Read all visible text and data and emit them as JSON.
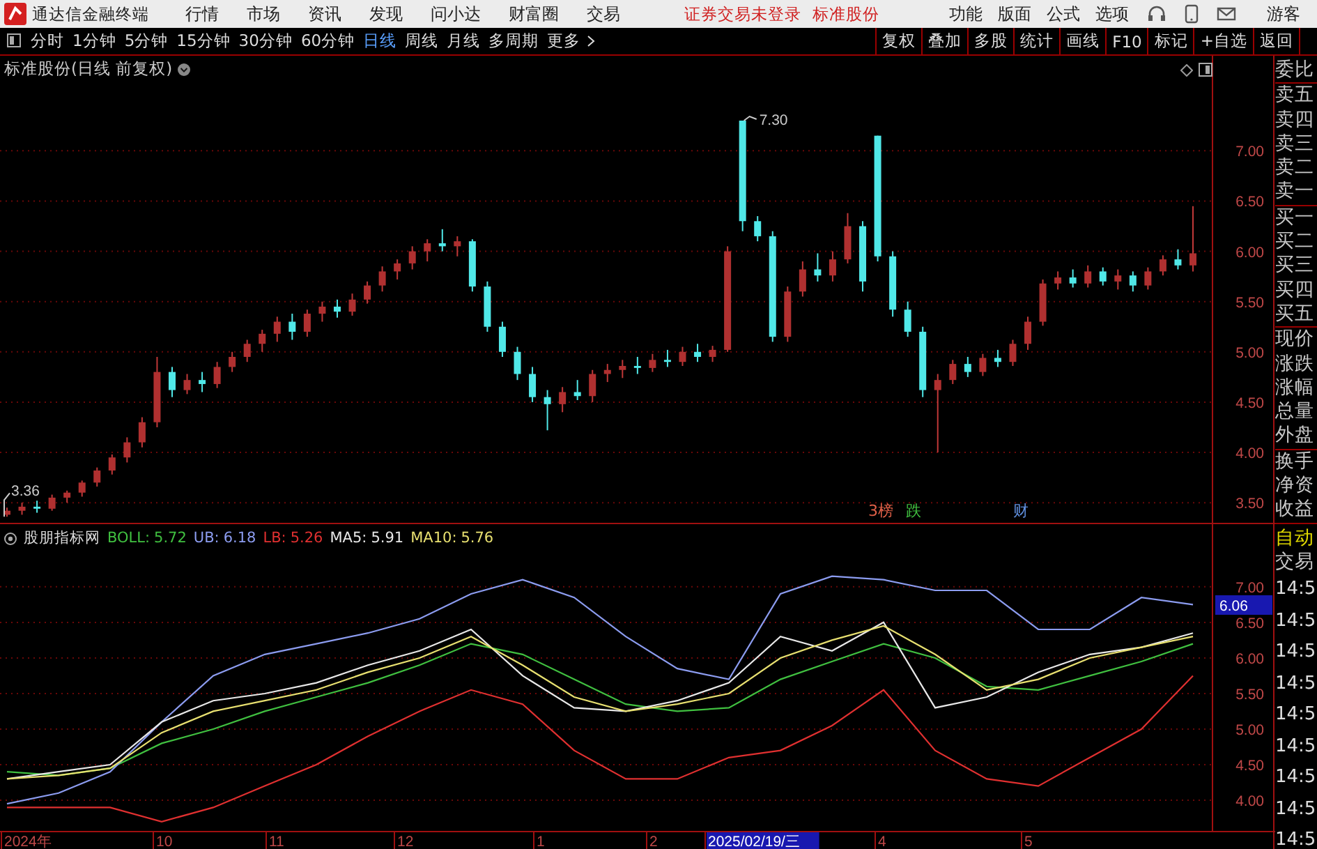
{
  "title_bar": {
    "app_name": "通达信金融终端",
    "menus": [
      "行情",
      "市场",
      "资讯",
      "发现",
      "问小达",
      "财富圈",
      "交易"
    ],
    "notice": "证券交易未登录",
    "stock_name": "标准股份",
    "tools": [
      "功能",
      "版面",
      "公式",
      "选项"
    ],
    "user": "游客"
  },
  "toolbar": {
    "periods": [
      {
        "label": "分时",
        "selected": false
      },
      {
        "label": "1分钟",
        "selected": false
      },
      {
        "label": "5分钟",
        "selected": false
      },
      {
        "label": "15分钟",
        "selected": false
      },
      {
        "label": "30分钟",
        "selected": false
      },
      {
        "label": "60分钟",
        "selected": false
      },
      {
        "label": "日线",
        "selected": true
      },
      {
        "label": "周线",
        "selected": false
      },
      {
        "label": "月线",
        "selected": false
      },
      {
        "label": "多周期",
        "selected": false
      }
    ],
    "more": "更多",
    "actions": [
      "复权",
      "叠加",
      "多股",
      "统计",
      "画线",
      "F10",
      "标记",
      "+自选",
      "返回"
    ]
  },
  "price_chart": {
    "title": "标准股份(日线 前复权)",
    "high_label": "7.30",
    "low_label": "3.36",
    "chart_data": {
      "type": "candlestick",
      "categories": [
        null,
        null,
        null,
        null,
        null,
        null,
        null,
        null,
        null,
        null,
        null,
        null,
        null,
        null,
        null,
        null,
        null,
        null,
        null,
        null,
        null,
        null,
        null,
        null,
        null,
        null,
        null,
        null,
        null,
        null,
        null,
        null,
        null,
        null,
        null,
        null,
        null,
        null,
        null,
        null,
        null,
        null,
        null,
        null,
        null,
        null,
        null,
        null,
        null,
        null,
        null,
        null,
        null,
        null,
        null,
        null,
        null,
        null,
        null,
        null,
        null,
        null,
        null,
        null,
        null,
        null,
        null,
        null,
        null,
        null,
        null,
        null,
        null,
        null,
        null,
        null,
        null,
        null,
        null,
        null
      ],
      "ylim": [
        3.3,
        7.945
      ],
      "grid": true,
      "yticks": [
        {
          "value": 7,
          "label": "7.00"
        },
        {
          "value": 6.5,
          "label": "6.50"
        },
        {
          "value": 6,
          "label": "6.00"
        },
        {
          "value": 5.5,
          "label": "5.50"
        },
        {
          "value": 5,
          "label": "5.00"
        },
        {
          "value": 4.5,
          "label": "4.50"
        },
        {
          "value": 4,
          "label": "4.00"
        },
        {
          "value": 3.5,
          "label": "3.50"
        }
      ],
      "ohlc": [
        [
          3.38,
          3.45,
          3.36,
          3.42
        ],
        [
          3.42,
          3.5,
          3.38,
          3.46
        ],
        [
          3.46,
          3.52,
          3.4,
          3.44
        ],
        [
          3.44,
          3.58,
          3.42,
          3.55
        ],
        [
          3.55,
          3.62,
          3.5,
          3.6
        ],
        [
          3.6,
          3.72,
          3.56,
          3.7
        ],
        [
          3.7,
          3.85,
          3.66,
          3.82
        ],
        [
          3.82,
          3.98,
          3.78,
          3.95
        ],
        [
          3.95,
          4.15,
          3.9,
          4.1
        ],
        [
          4.1,
          4.35,
          4.05,
          4.3
        ],
        [
          4.3,
          4.95,
          4.25,
          4.8
        ],
        [
          4.8,
          4.85,
          4.55,
          4.62
        ],
        [
          4.62,
          4.78,
          4.58,
          4.72
        ],
        [
          4.72,
          4.8,
          4.6,
          4.68
        ],
        [
          4.68,
          4.9,
          4.64,
          4.85
        ],
        [
          4.85,
          5.0,
          4.8,
          4.95
        ],
        [
          4.95,
          5.12,
          4.9,
          5.08
        ],
        [
          5.08,
          5.22,
          5.0,
          5.18
        ],
        [
          5.18,
          5.35,
          5.1,
          5.3
        ],
        [
          5.3,
          5.38,
          5.12,
          5.2
        ],
        [
          5.2,
          5.42,
          5.15,
          5.38
        ],
        [
          5.38,
          5.5,
          5.3,
          5.45
        ],
        [
          5.45,
          5.52,
          5.34,
          5.4
        ],
        [
          5.4,
          5.58,
          5.36,
          5.52
        ],
        [
          5.52,
          5.7,
          5.48,
          5.66
        ],
        [
          5.66,
          5.85,
          5.6,
          5.8
        ],
        [
          5.8,
          5.92,
          5.72,
          5.88
        ],
        [
          5.88,
          6.05,
          5.82,
          6.0
        ],
        [
          6.0,
          6.12,
          5.9,
          6.08
        ],
        [
          6.08,
          6.22,
          6.0,
          6.05
        ],
        [
          6.05,
          6.15,
          5.95,
          6.1
        ],
        [
          6.1,
          6.12,
          5.6,
          5.65
        ],
        [
          5.65,
          5.7,
          5.2,
          5.25
        ],
        [
          5.25,
          5.3,
          4.95,
          5.0
        ],
        [
          5.0,
          5.05,
          4.72,
          4.78
        ],
        [
          4.78,
          4.85,
          4.5,
          4.55
        ],
        [
          4.55,
          4.62,
          4.22,
          4.48
        ],
        [
          4.48,
          4.65,
          4.4,
          4.6
        ],
        [
          4.6,
          4.72,
          4.52,
          4.56
        ],
        [
          4.56,
          4.82,
          4.5,
          4.78
        ],
        [
          4.78,
          4.88,
          4.7,
          4.82
        ],
        [
          4.82,
          4.92,
          4.74,
          4.86
        ],
        [
          4.86,
          4.95,
          4.78,
          4.84
        ],
        [
          4.84,
          4.98,
          4.8,
          4.92
        ],
        [
          4.92,
          5.02,
          4.85,
          4.9
        ],
        [
          4.9,
          5.05,
          4.86,
          5.0
        ],
        [
          5.0,
          5.08,
          4.9,
          4.95
        ],
        [
          4.95,
          5.06,
          4.9,
          5.02
        ],
        [
          5.02,
          6.05,
          5.0,
          6.0
        ],
        [
          7.3,
          7.3,
          6.2,
          6.3
        ],
        [
          6.3,
          6.35,
          6.1,
          6.15
        ],
        [
          6.15,
          6.2,
          5.1,
          5.15
        ],
        [
          5.15,
          5.65,
          5.1,
          5.6
        ],
        [
          5.6,
          5.9,
          5.55,
          5.82
        ],
        [
          5.82,
          5.98,
          5.7,
          5.76
        ],
        [
          5.76,
          6.0,
          5.7,
          5.92
        ],
        [
          5.92,
          6.38,
          5.88,
          6.25
        ],
        [
          6.25,
          6.3,
          5.6,
          5.7
        ],
        [
          7.15,
          7.15,
          5.9,
          5.95
        ],
        [
          5.95,
          6.0,
          5.35,
          5.42
        ],
        [
          5.42,
          5.5,
          5.15,
          5.2
        ],
        [
          5.2,
          5.25,
          4.55,
          4.62
        ],
        [
          4.62,
          4.78,
          4.0,
          4.72
        ],
        [
          4.72,
          4.92,
          4.68,
          4.88
        ],
        [
          4.88,
          4.95,
          4.75,
          4.8
        ],
        [
          4.8,
          4.98,
          4.76,
          4.94
        ],
        [
          4.94,
          5.02,
          4.85,
          4.9
        ],
        [
          4.9,
          5.12,
          4.86,
          5.08
        ],
        [
          5.08,
          5.35,
          5.02,
          5.3
        ],
        [
          5.3,
          5.72,
          5.26,
          5.68
        ],
        [
          5.68,
          5.8,
          5.62,
          5.74
        ],
        [
          5.74,
          5.82,
          5.64,
          5.68
        ],
        [
          5.68,
          5.86,
          5.64,
          5.8
        ],
        [
          5.8,
          5.84,
          5.66,
          5.7
        ],
        [
          5.7,
          5.82,
          5.62,
          5.76
        ],
        [
          5.76,
          5.8,
          5.6,
          5.66
        ],
        [
          5.66,
          5.84,
          5.62,
          5.8
        ],
        [
          5.8,
          5.96,
          5.76,
          5.92
        ],
        [
          5.92,
          6.02,
          5.82,
          5.86
        ],
        [
          5.86,
          6.45,
          5.8,
          5.98
        ]
      ]
    },
    "event_markers": [
      {
        "label": "3榜",
        "color": "#e06048"
      },
      {
        "label": "跌",
        "color": "#40c040"
      },
      {
        "label": "财",
        "color": "#6090e0"
      }
    ]
  },
  "indicator": {
    "name": "股朋指标网",
    "legend": [
      "5.72",
      "6.18",
      "5.26",
      "5.91",
      "5.76"
    ],
    "current_value": "6.06",
    "chart_data": {
      "type": "line",
      "categories": [
        null,
        null,
        null,
        null,
        null,
        null,
        null,
        null,
        null,
        null,
        null,
        null,
        null,
        null,
        null,
        null,
        null,
        null,
        null,
        null,
        null,
        null,
        null,
        null
      ],
      "ylim": [
        3.57,
        7.88
      ],
      "grid": true,
      "yticks": [
        {
          "value": 7,
          "label": "7.00"
        },
        {
          "value": 6.5,
          "label": "6.50"
        },
        {
          "value": 6,
          "label": "6.00"
        },
        {
          "value": 5.5,
          "label": "5.50"
        },
        {
          "value": 5,
          "label": "5.00"
        },
        {
          "value": 4.5,
          "label": "4.50"
        },
        {
          "value": 4,
          "label": "4.00"
        }
      ],
      "series": [
        {
          "name": "BOLL:",
          "color": "#40c040",
          "values": [
            4.4,
            4.35,
            4.45,
            4.8,
            5.0,
            5.25,
            5.45,
            5.65,
            5.9,
            6.2,
            6.05,
            5.7,
            5.35,
            5.25,
            5.3,
            5.7,
            5.95,
            6.2,
            6.0,
            5.6,
            5.55,
            5.75,
            5.95,
            6.2
          ]
        },
        {
          "name": "UB:",
          "color": "#8c9cf0",
          "values": [
            3.95,
            4.1,
            4.4,
            5.1,
            5.75,
            6.05,
            6.2,
            6.35,
            6.55,
            6.9,
            7.1,
            6.85,
            6.3,
            5.85,
            5.7,
            6.9,
            7.15,
            7.1,
            6.95,
            6.95,
            6.4,
            6.4,
            6.85,
            6.75
          ]
        },
        {
          "name": "LB:",
          "color": "#e03030",
          "values": [
            3.9,
            3.9,
            3.9,
            3.7,
            3.9,
            4.2,
            4.5,
            4.9,
            5.25,
            5.55,
            5.35,
            4.7,
            4.3,
            4.3,
            4.6,
            4.7,
            5.05,
            5.55,
            4.7,
            4.3,
            4.2,
            4.6,
            5.0,
            5.75
          ]
        },
        {
          "name": "MA5:",
          "color": "#e8e8e8",
          "values": [
            4.3,
            4.4,
            4.5,
            5.1,
            5.4,
            5.5,
            5.65,
            5.9,
            6.1,
            6.4,
            5.75,
            5.3,
            5.25,
            5.4,
            5.65,
            6.3,
            6.1,
            6.5,
            5.3,
            5.45,
            5.8,
            6.05,
            6.15,
            6.35
          ]
        },
        {
          "name": "MA10:",
          "color": "#e8e070",
          "values": [
            4.3,
            4.35,
            4.45,
            4.95,
            5.25,
            5.4,
            5.55,
            5.8,
            6.0,
            6.3,
            5.9,
            5.45,
            5.25,
            5.35,
            5.5,
            6.0,
            6.25,
            6.45,
            6.05,
            5.55,
            5.7,
            6.0,
            6.15,
            6.3
          ]
        }
      ]
    }
  },
  "x_axis": {
    "labels": [
      {
        "label": "2024年",
        "selected": false
      },
      {
        "label": "10",
        "selected": false
      },
      {
        "label": "11",
        "selected": false
      },
      {
        "label": "12",
        "selected": false
      },
      {
        "label": "1",
        "selected": false
      },
      {
        "label": "2",
        "selected": false
      },
      {
        "label": "2025/02/19/三",
        "selected": true
      },
      {
        "label": "4",
        "selected": false
      },
      {
        "label": "5",
        "selected": false
      }
    ]
  },
  "side_panel": {
    "quote_groups": [
      [
        "委比"
      ],
      [
        "卖五",
        "卖四",
        "卖三",
        "卖二",
        "卖一"
      ],
      [
        "买一",
        "买二",
        "买三",
        "买四",
        "买五"
      ],
      [
        "现价",
        "涨跌",
        "涨幅",
        "总量",
        "外盘"
      ],
      [
        "换手",
        "净资",
        "收益"
      ]
    ],
    "trade_labels": [
      "自动",
      "交易"
    ],
    "times": [
      "14:5",
      "14:5",
      "14:5",
      "14:5",
      "14:5",
      "14:5",
      "14:5",
      "14:5",
      "14:5"
    ]
  }
}
